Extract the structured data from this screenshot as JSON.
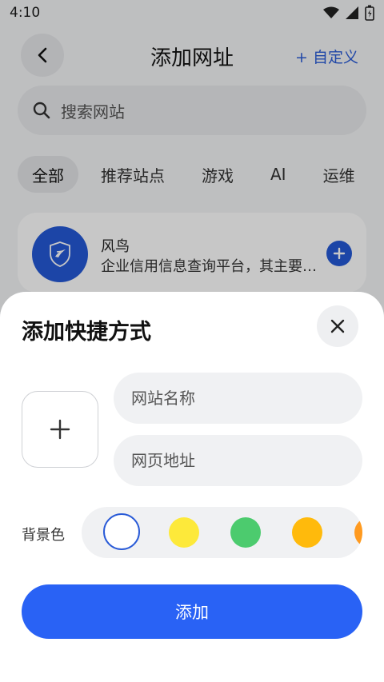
{
  "status_bar": {
    "time": "4:10"
  },
  "header": {
    "title": "添加网址",
    "custom_link": "+ 自定义"
  },
  "search": {
    "placeholder": "搜索网站"
  },
  "tabs": [
    {
      "label": "全部",
      "active": true
    },
    {
      "label": "推荐站点",
      "active": false
    },
    {
      "label": "游戏",
      "active": false
    },
    {
      "label": "AI",
      "active": false
    },
    {
      "label": "运维",
      "active": false
    }
  ],
  "site_card": {
    "name": "风鸟",
    "description": "企业信用信息查询平台，其主要功能包括",
    "logo_color": "#2459d6"
  },
  "sheet": {
    "title": "添加快捷方式",
    "name_placeholder": "网站名称",
    "url_placeholder": "网页地址",
    "bg_color_label": "背景色",
    "colors": [
      "#ffffff",
      "#fde93a",
      "#4ccb6e",
      "#ffba0c",
      "#ff9a1f"
    ],
    "selected_color_index": 0,
    "submit_label": "添加"
  },
  "accent_color": "#2962f5"
}
